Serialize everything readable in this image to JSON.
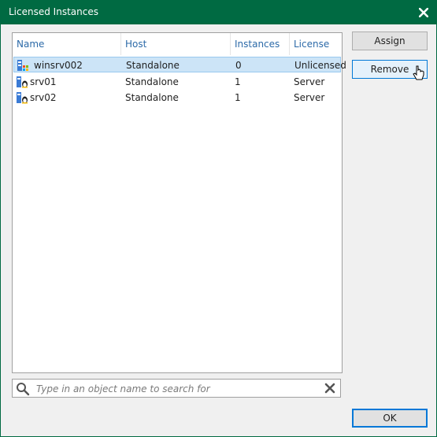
{
  "window": {
    "title": "Licensed Instances"
  },
  "columns": [
    "Name",
    "Host",
    "Instances",
    "License"
  ],
  "rows": [
    {
      "name": "winsrv002",
      "host": "Standalone",
      "instances": "0",
      "license": "Unlicensed",
      "icon": "windows-server-icon"
    },
    {
      "name": "srv01",
      "host": "Standalone",
      "instances": "1",
      "license": "Server",
      "icon": "linux-server-icon"
    },
    {
      "name": "srv02",
      "host": "Standalone",
      "instances": "1",
      "license": "Server",
      "icon": "linux-server-icon"
    }
  ],
  "search": {
    "placeholder": "Type in an object name to search for"
  },
  "buttons": {
    "assign": "Assign",
    "remove": "Remove",
    "ok": "OK"
  },
  "colors": {
    "titlebar": "#006a42",
    "selection": "#cce4f7",
    "header_text": "#2c6aa8"
  }
}
